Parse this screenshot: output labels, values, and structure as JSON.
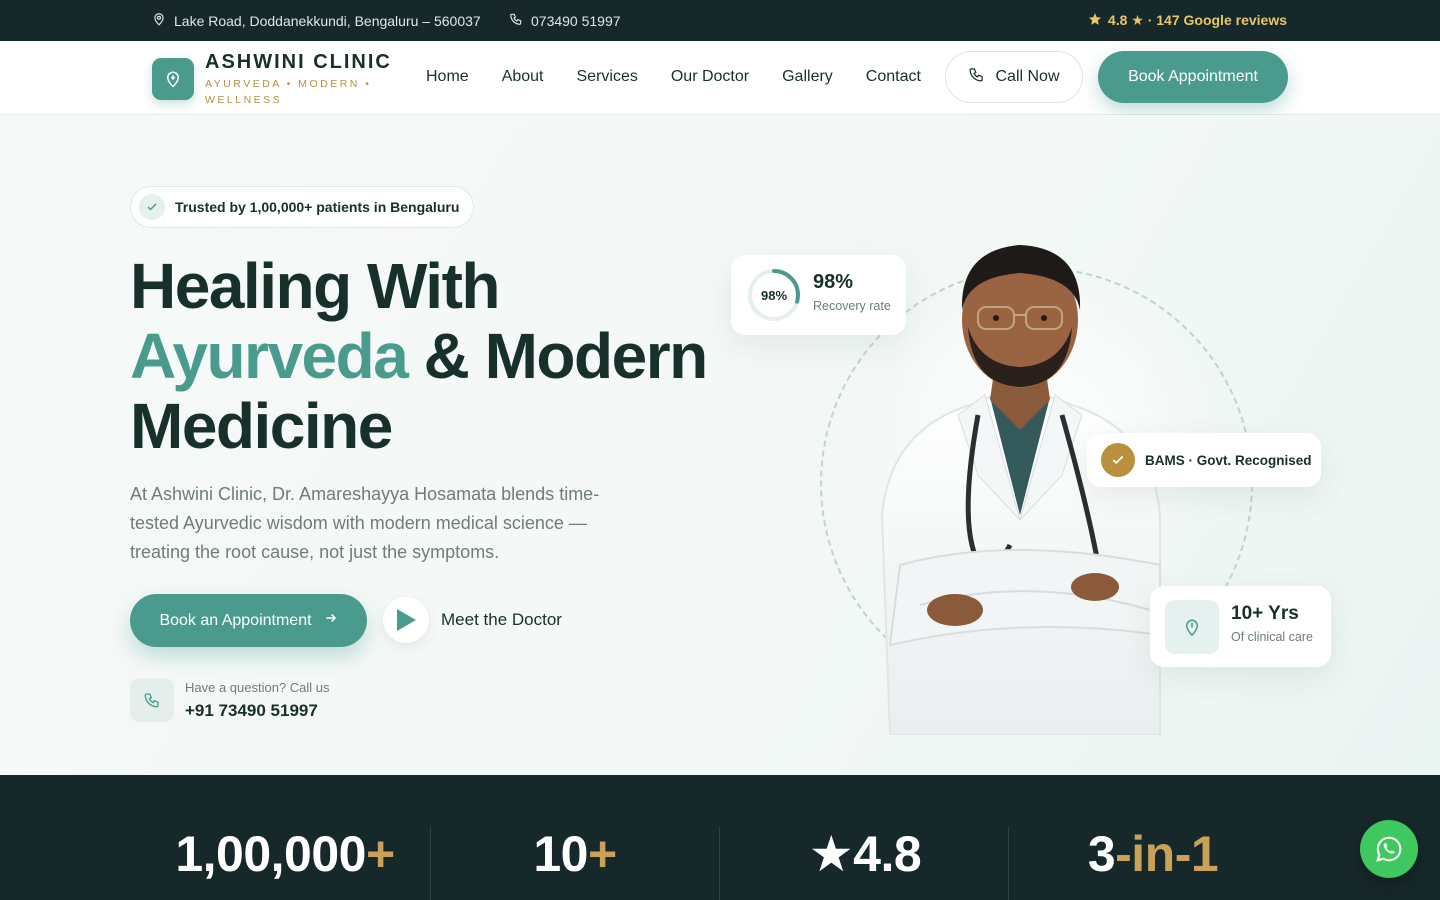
{
  "topbar": {
    "address": "Lake Road, Doddanekkundi, Bengaluru – 560037",
    "phone": "073490 51997",
    "rating": "4.8 ★ · 147 Google reviews"
  },
  "header": {
    "brand_name": "ASHWINI CLINIC",
    "brand_tagline": "AYURVEDA • MODERN • WELLNESS",
    "nav": [
      "Home",
      "About",
      "Services",
      "Our Doctor",
      "Gallery",
      "Contact"
    ],
    "call_label": "Call Now",
    "book_label": "Book Appointment"
  },
  "hero": {
    "trust_badge": "Trusted by 1,00,000+ patients in Bengaluru",
    "headline_1": "Healing With",
    "headline_accent": "Ayurveda",
    "headline_2": " & Modern",
    "headline_3": "Medicine",
    "description": "At Ashwini Clinic, Dr. Amareshayya Hosamata blends time-tested Ayurvedic wisdom with modern medical science — treating the root cause, not just the symptoms.",
    "cta_primary": "Book an Appointment",
    "cta_secondary": "Meet the Doctor",
    "ask_label": "Have a question? Call us",
    "ask_number": "+91 73490 51997"
  },
  "cards": {
    "recovery_ring": "98%",
    "recovery_value": "98%",
    "recovery_label": "Recovery rate",
    "recovery_fraction": 0.98,
    "bams": "BAMS · Govt. Recognised",
    "years_value": "10+ Yrs",
    "years_label": "Of clinical care"
  },
  "stats": [
    {
      "value": "1,00,000",
      "suffix": "+"
    },
    {
      "value": "10",
      "suffix": "+"
    },
    {
      "value": "★4.8",
      "suffix": ""
    },
    {
      "value": "3",
      "suffix": "-in-1"
    }
  ],
  "colors": {
    "accent": "#4a9b8e",
    "dark": "#16282a",
    "gold": "#b8903e",
    "whatsapp": "#3fc85f"
  }
}
